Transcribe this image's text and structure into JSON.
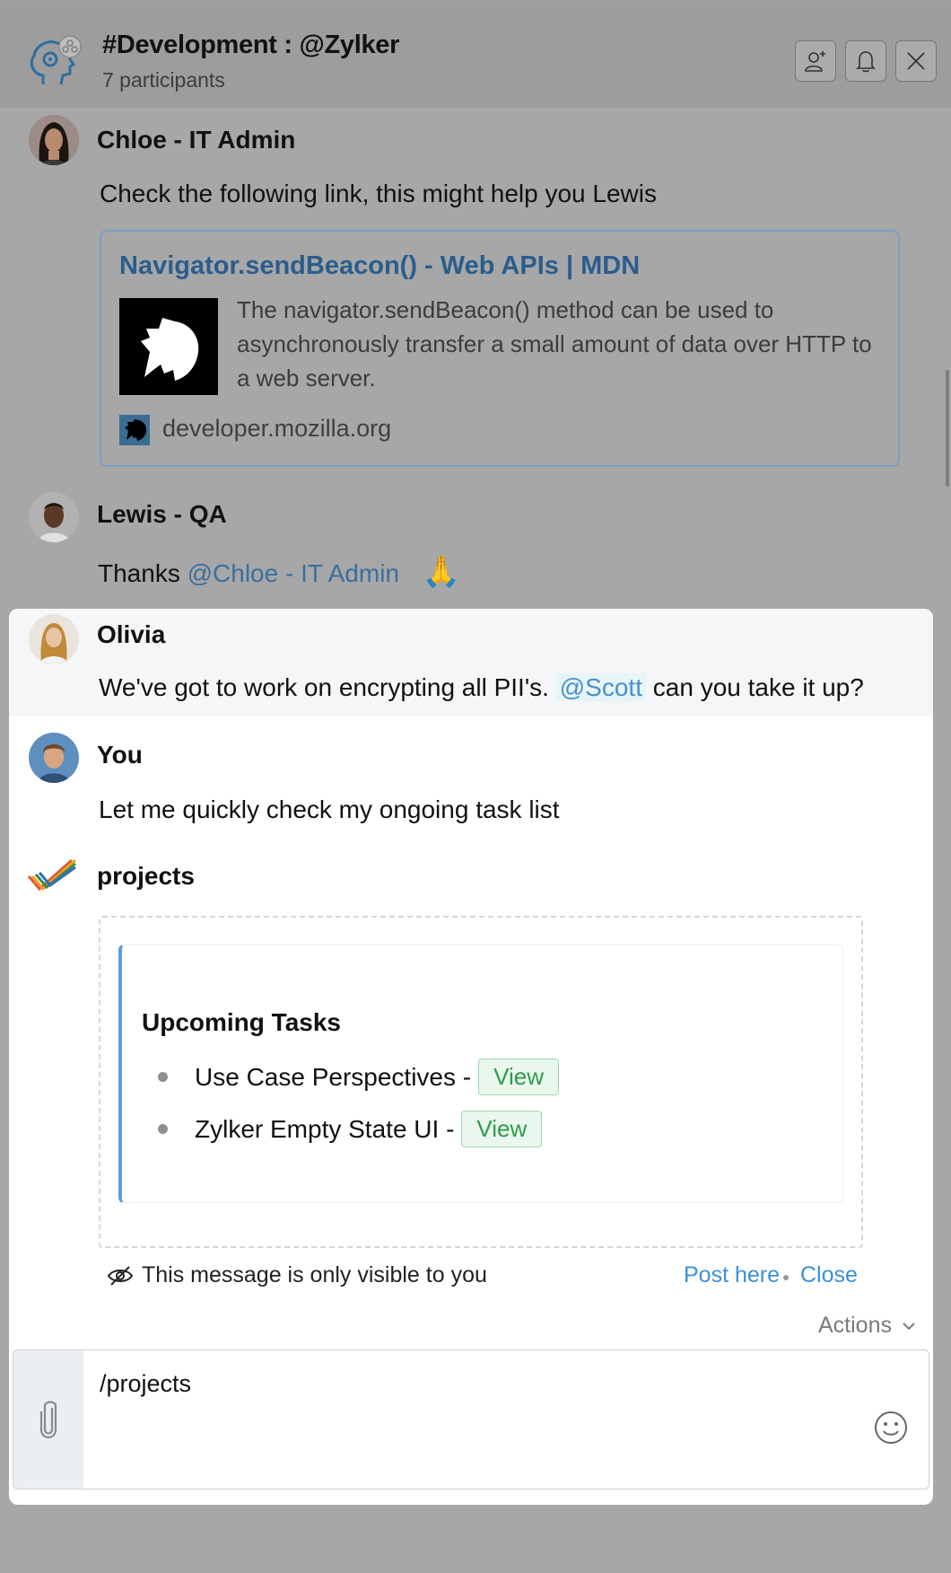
{
  "header": {
    "title": "#Development : @Zylker",
    "participants": "7 participants",
    "icons": [
      "add-participant-icon",
      "bell-icon",
      "close-icon"
    ]
  },
  "messages": [
    {
      "sender": "Chloe - IT Admin",
      "text": "Check the following link, this might help you Lewis",
      "link_preview": {
        "title": "Navigator.sendBeacon() - Web APIs | MDN",
        "description": "The navigator.sendBeacon() method can be used to asynchronously transfer a small amount of data over HTTP to a web server.",
        "domain": "developer.mozilla.org"
      }
    },
    {
      "sender": "Lewis - QA",
      "text_before": "Thanks ",
      "mention": "@Chloe - IT Admin",
      "emoji": "🙏"
    },
    {
      "sender": "Olivia",
      "text_before": "We've got to work on encrypting all PII's. ",
      "mention": "@Scott",
      "text_after": " can you take it up?"
    },
    {
      "sender": "You",
      "text": "Let me quickly check my ongoing task list"
    }
  ],
  "bot": {
    "name": "projects",
    "card_title": "Upcoming Tasks",
    "tasks": [
      {
        "name": "Use Case Perspectives - ",
        "action": "View"
      },
      {
        "name": "Zylker Empty State UI - ",
        "action": "View"
      }
    ],
    "visibility_note": "This message is only visible to you",
    "post_here": "Post here",
    "close": "Close",
    "actions": "Actions"
  },
  "composer": {
    "value": "/projects"
  },
  "colors": {
    "link": "#3d8fd6",
    "view_button_text": "#2f9a4e",
    "card_accent": "#5b9be0"
  }
}
